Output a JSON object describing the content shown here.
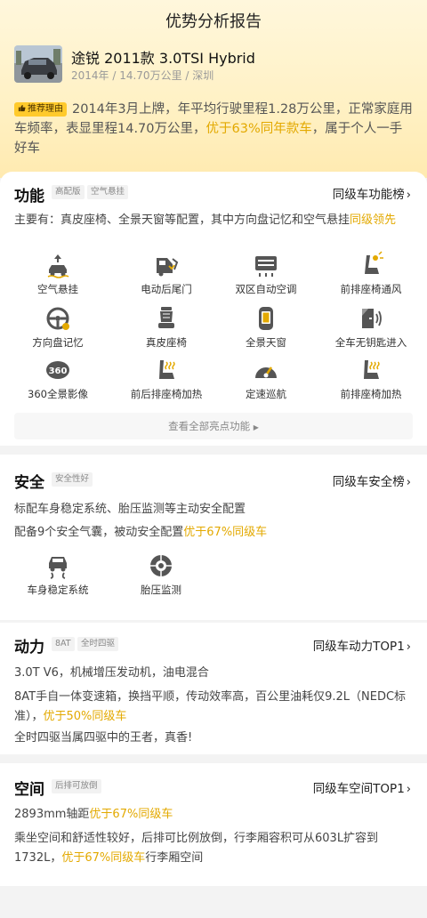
{
  "header": {
    "title": "优势分析报告"
  },
  "car": {
    "name": "途锐 2011款 3.0TSI Hybrid",
    "meta": "2014年 / 14.70万公里 / 深圳"
  },
  "reason": {
    "tag": "推荐理由",
    "text_a": "2014年3月上牌，年平均行驶里程1.28万公里，正常家庭用车频率，表显里程14.70万公里，",
    "highlight": "优于63%同年款车",
    "text_b": "，属于个人一手好车"
  },
  "function_section": {
    "title": "功能",
    "chips": [
      "高配版",
      "空气悬挂"
    ],
    "rank": "同级车功能榜",
    "desc_a": "主要有：真皮座椅、全景天窗等配置，其中方向盘记忆和空气悬挂",
    "desc_hl": "同级领先",
    "features": [
      {
        "icon": "air-suspension-icon",
        "label": "空气悬挂"
      },
      {
        "icon": "power-tailgate-icon",
        "label": "电动后尾门"
      },
      {
        "icon": "dual-zone-ac-icon",
        "label": "双区自动空调"
      },
      {
        "icon": "seat-ventilation-icon",
        "label": "前排座椅通风"
      },
      {
        "icon": "steering-memory-icon",
        "label": "方向盘记忆"
      },
      {
        "icon": "leather-seat-icon",
        "label": "真皮座椅"
      },
      {
        "icon": "panoramic-roof-icon",
        "label": "全景天窗"
      },
      {
        "icon": "keyless-entry-icon",
        "label": "全车无钥匙进入"
      },
      {
        "icon": "camera-360-icon",
        "label": "360全景影像"
      },
      {
        "icon": "seat-heating-icon",
        "label": "前后排座椅加热"
      },
      {
        "icon": "cruise-control-icon",
        "label": "定速巡航"
      },
      {
        "icon": "seat-heating-icon",
        "label": "前排座椅加热"
      }
    ],
    "view_all": "查看全部亮点功能"
  },
  "safety_section": {
    "title": "安全",
    "chips": [
      "安全性好"
    ],
    "rank": "同级车安全榜",
    "line1": "标配车身稳定系统、胎压监测等主动安全配置",
    "line2_a": "配备9个安全气囊，被动安全配置",
    "line2_hl": "优于67%同级车",
    "features": [
      {
        "icon": "stability-control-icon",
        "label": "车身稳定系统"
      },
      {
        "icon": "tire-pressure-icon",
        "label": "胎压监测"
      }
    ]
  },
  "power_section": {
    "title": "动力",
    "chips": [
      "8AT",
      "全时四驱"
    ],
    "rank": "同级车动力TOP1",
    "line1": "3.0T V6，机械增压发动机，油电混合",
    "line2_a": "8AT手自一体变速箱，换挡平顺，传动效率高，百公里油耗仅9.2L（NEDC标准），",
    "line2_hl": "优于50%同级车",
    "line3": "全时四驱当属四驱中的王者，真香!"
  },
  "space_section": {
    "title": "空间",
    "chips": [
      "后排可放倒"
    ],
    "rank": "同级车空间TOP1",
    "line1_a": "2893mm轴距",
    "line1_hl": "优于67%同级车",
    "line2_a": "乘坐空间和舒适性较好，后排可比例放倒，行李厢容积可从603L扩容到1732L，",
    "line2_hl": "优于67%同级车",
    "line2_b": "行李厢空间"
  },
  "colors": {
    "accent": "#e3a900",
    "tag_bg": "#ffca2c"
  }
}
